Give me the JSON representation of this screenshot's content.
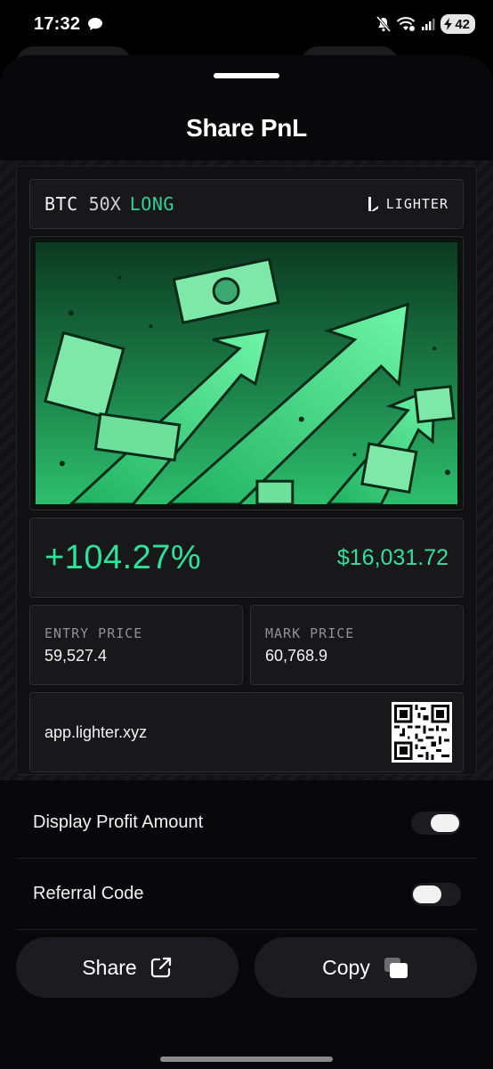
{
  "status_bar": {
    "time": "17:32",
    "battery": "42"
  },
  "sheet": {
    "title": "Share PnL"
  },
  "card": {
    "pair": "BTC",
    "leverage": "50X",
    "side": "LONG",
    "brand": "LIGHTER",
    "pnl_percent": "+104.27%",
    "pnl_amount": "$16,031.72",
    "entry_label": "ENTRY PRICE",
    "entry_value": "59,527.4",
    "mark_label": "MARK PRICE",
    "mark_value": "60,768.9",
    "link": "app.lighter.xyz"
  },
  "settings": [
    {
      "label": "Display Profit Amount",
      "enabled": true
    },
    {
      "label": "Referral Code",
      "enabled": false
    }
  ],
  "actions": {
    "share_label": "Share",
    "copy_label": "Copy"
  },
  "colors": {
    "accent": "#2fe29b",
    "background": "#08080a",
    "panel": "#18181b"
  },
  "icons": [
    "chat-icon",
    "mute-icon",
    "wifi-icon",
    "signal-icon",
    "battery-icon",
    "lighter-logo-icon",
    "qr-code-icon",
    "share-icon",
    "copy-icon"
  ]
}
